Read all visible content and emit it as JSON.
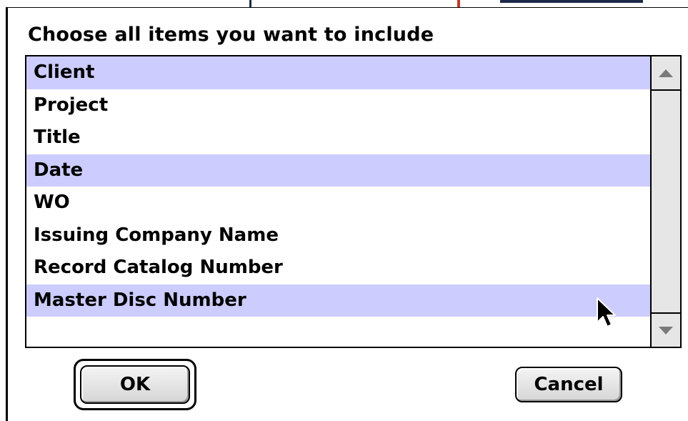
{
  "dialog": {
    "prompt": "Choose all items you want to include",
    "items": [
      {
        "label": "Client",
        "selected": true
      },
      {
        "label": "Project",
        "selected": false
      },
      {
        "label": "Title",
        "selected": false
      },
      {
        "label": "Date",
        "selected": true
      },
      {
        "label": "WO",
        "selected": false
      },
      {
        "label": "Issuing Company Name",
        "selected": false
      },
      {
        "label": "Record Catalog Number",
        "selected": false
      },
      {
        "label": "Master Disc Number",
        "selected": true
      }
    ],
    "ok_label": "OK",
    "cancel_label": "Cancel"
  },
  "colors": {
    "selection": "#ccccff",
    "scrollbar": "#e6e6e6",
    "arrow": "#7a7a7a"
  },
  "icons": {
    "scroll_up": "triangle-up",
    "scroll_down": "triangle-down",
    "pointer": "arrow-cursor"
  }
}
